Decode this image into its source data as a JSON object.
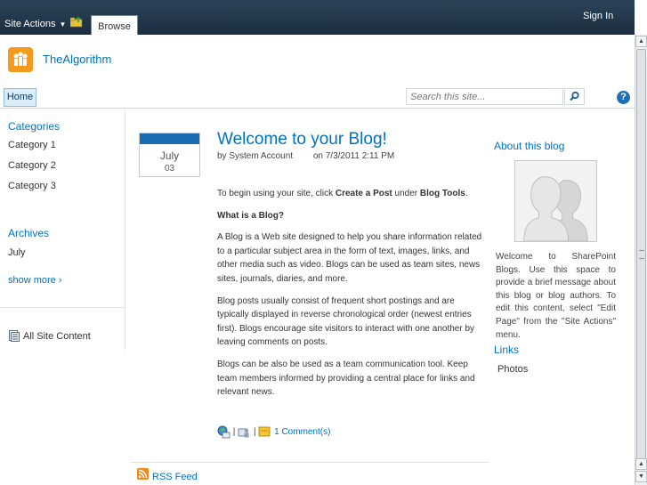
{
  "ribbon": {
    "site_actions": "Site Actions",
    "browse_tab": "Browse",
    "sign_in": "Sign In"
  },
  "site": {
    "title": "TheAlgorithm"
  },
  "topnav": {
    "home": "Home",
    "search_placeholder": "Search this site...",
    "help": "?"
  },
  "leftnav": {
    "categories_heading": "Categories",
    "categories": [
      "Category 1",
      "Category 2",
      "Category 3"
    ],
    "archives_heading": "Archives",
    "archives": [
      "July"
    ],
    "show_more": "show more ›",
    "all_site_content": "All Site Content"
  },
  "post": {
    "month": "July",
    "day": "03",
    "title": "Welcome to your Blog!",
    "by": "by",
    "author": "System Account",
    "on": "on 7/3/2011 2:11 PM",
    "p1_a": "To begin using your site, click ",
    "p1_b": "Create a Post",
    "p1_c": " under ",
    "p1_d": "Blog Tools",
    "p1_e": ".",
    "q": "What is a Blog?",
    "p2": "A Blog is a Web site designed to help you share information related to a particular subject area in the form of text, images, links, and other media such as video. Blogs can be used as team sites, news sites, journals, diaries, and more.",
    "p3": "Blog posts usually consist of frequent short postings and are typically displayed in reverse chronological order (newest entries first). Blogs encourage site visitors to interact with one another by leaving comments on posts.",
    "p4": "Blogs can be also be used as a team communication tool. Keep team members informed by providing a central place for links and relevant news.",
    "sep": "|",
    "comments": "1 Comment(s)",
    "rss": "RSS Feed"
  },
  "right": {
    "about_heading": "About this blog",
    "about_text": "Welcome to SharePoint Blogs. Use this space to provide a brief message about this blog or blog authors. To edit this content, select \"Edit Page\" from the \"Site Actions\" menu.",
    "links_heading": "Links",
    "links": [
      "Photos"
    ]
  },
  "icons": {
    "folder": "navigate-up-icon",
    "logo": "people-logo-icon",
    "search": "search-icon",
    "help": "help-icon",
    "all_site_content": "document-list-icon",
    "email": "email-link-icon",
    "users": "users-icon",
    "comment": "comment-icon",
    "rss": "rss-icon"
  },
  "colors": {
    "ribbon": "#21374c",
    "link": "#0072bc",
    "date_bar": "#1a6bb1"
  }
}
